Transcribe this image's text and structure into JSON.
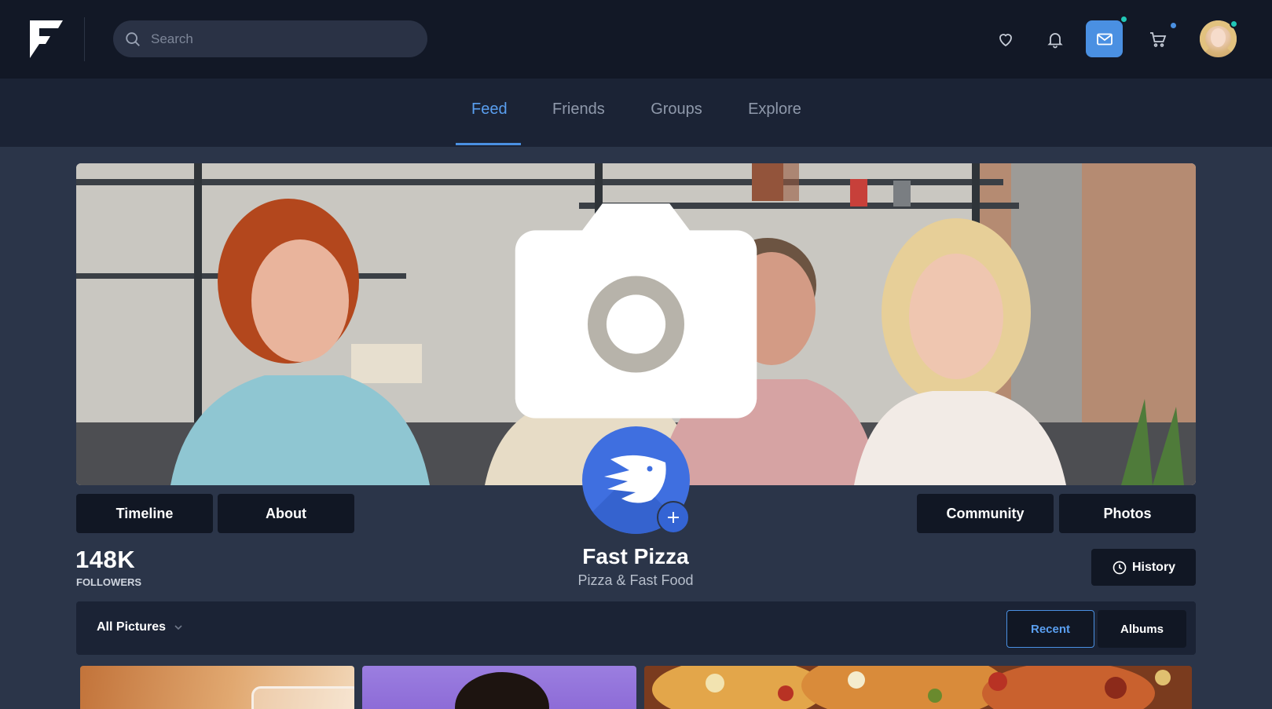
{
  "header": {
    "search": {
      "placeholder": "Search",
      "value": ""
    },
    "icons": [
      "heart-icon",
      "bell-icon",
      "mail-icon",
      "cart-icon"
    ],
    "notifications": {
      "mail_dot_color": "#21c7b6",
      "cart_dot_color": "#4a90e2",
      "avatar_status_color": "#21c7b6"
    }
  },
  "nav": {
    "tabs": [
      {
        "label": "Feed",
        "active": true
      },
      {
        "label": "Friends",
        "active": false
      },
      {
        "label": "Groups",
        "active": false
      },
      {
        "label": "Explore",
        "active": false
      }
    ]
  },
  "profile": {
    "name": "Fast Pizza",
    "category": "Pizza & Fast Food",
    "followers_count": "148K",
    "followers_label": "FOLLOWERS",
    "buttons": {
      "timeline": "Timeline",
      "about": "About",
      "community": "Community",
      "photos": "Photos",
      "history": "History"
    }
  },
  "gallery": {
    "filter_label": "All Pictures",
    "view_buttons": {
      "recent": "Recent",
      "albums": "Albums"
    }
  },
  "colors": {
    "accent": "#4a90e2",
    "background": "#2b3549",
    "topbar": "#121826",
    "panel": "#1b2335",
    "button_dark": "#111724",
    "avatar_brand": "#3f6fe0"
  }
}
